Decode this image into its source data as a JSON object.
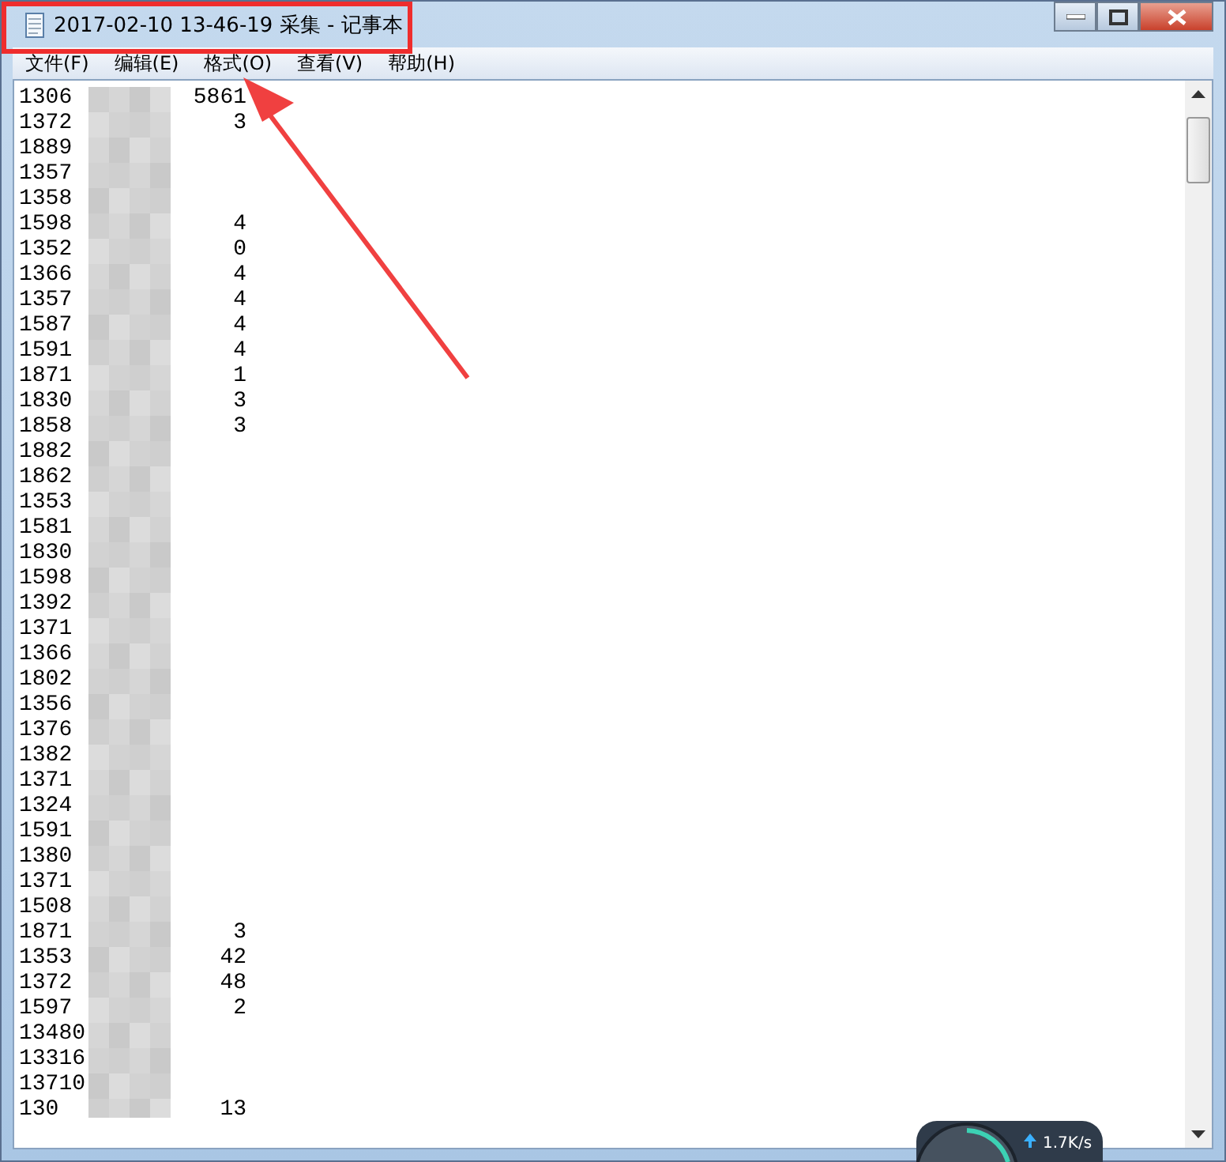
{
  "window": {
    "title": "2017-02-10 13-46-19 采集 - 记事本"
  },
  "menu": [
    "文件(F)",
    "编辑(E)",
    "格式(O)",
    "查看(V)",
    "帮助(H)"
  ],
  "lines": [
    {
      "text": "1306",
      "tail": "5861"
    },
    {
      "text": "1372",
      "tail": "3"
    },
    {
      "text": "1889"
    },
    {
      "text": "1357"
    },
    {
      "text": "1358"
    },
    {
      "text": "1598",
      "tail": "4"
    },
    {
      "text": "1352",
      "tail": "0"
    },
    {
      "text": "1366",
      "tail": "4"
    },
    {
      "text": "1357",
      "tail": "4"
    },
    {
      "text": "1587",
      "tail": "4"
    },
    {
      "text": "1591",
      "tail": "4"
    },
    {
      "text": "1871",
      "tail": "1"
    },
    {
      "text": "1830",
      "tail": "3"
    },
    {
      "text": "1858",
      "tail": "3"
    },
    {
      "text": "1882"
    },
    {
      "text": "1862"
    },
    {
      "text": "1353"
    },
    {
      "text": "1581"
    },
    {
      "text": "1830"
    },
    {
      "text": "1598"
    },
    {
      "text": "1392"
    },
    {
      "text": "1371"
    },
    {
      "text": "1366"
    },
    {
      "text": "1802"
    },
    {
      "text": "1356"
    },
    {
      "text": "1376"
    },
    {
      "text": "1382"
    },
    {
      "text": "1371"
    },
    {
      "text": "1324"
    },
    {
      "text": "1591"
    },
    {
      "text": "1380"
    },
    {
      "text": "1371"
    },
    {
      "text": "1508"
    },
    {
      "text": "1871",
      "tail": "3"
    },
    {
      "text": "1353",
      "tail": "42"
    },
    {
      "text": "1372",
      "tail": "48"
    },
    {
      "text": "1597",
      "tail": "2"
    },
    {
      "text": "13480"
    },
    {
      "text": "13316"
    },
    {
      "text": "13710"
    },
    {
      "text": "130",
      "tail": "13"
    }
  ],
  "net_widget": {
    "upload": "1.7K/s"
  }
}
